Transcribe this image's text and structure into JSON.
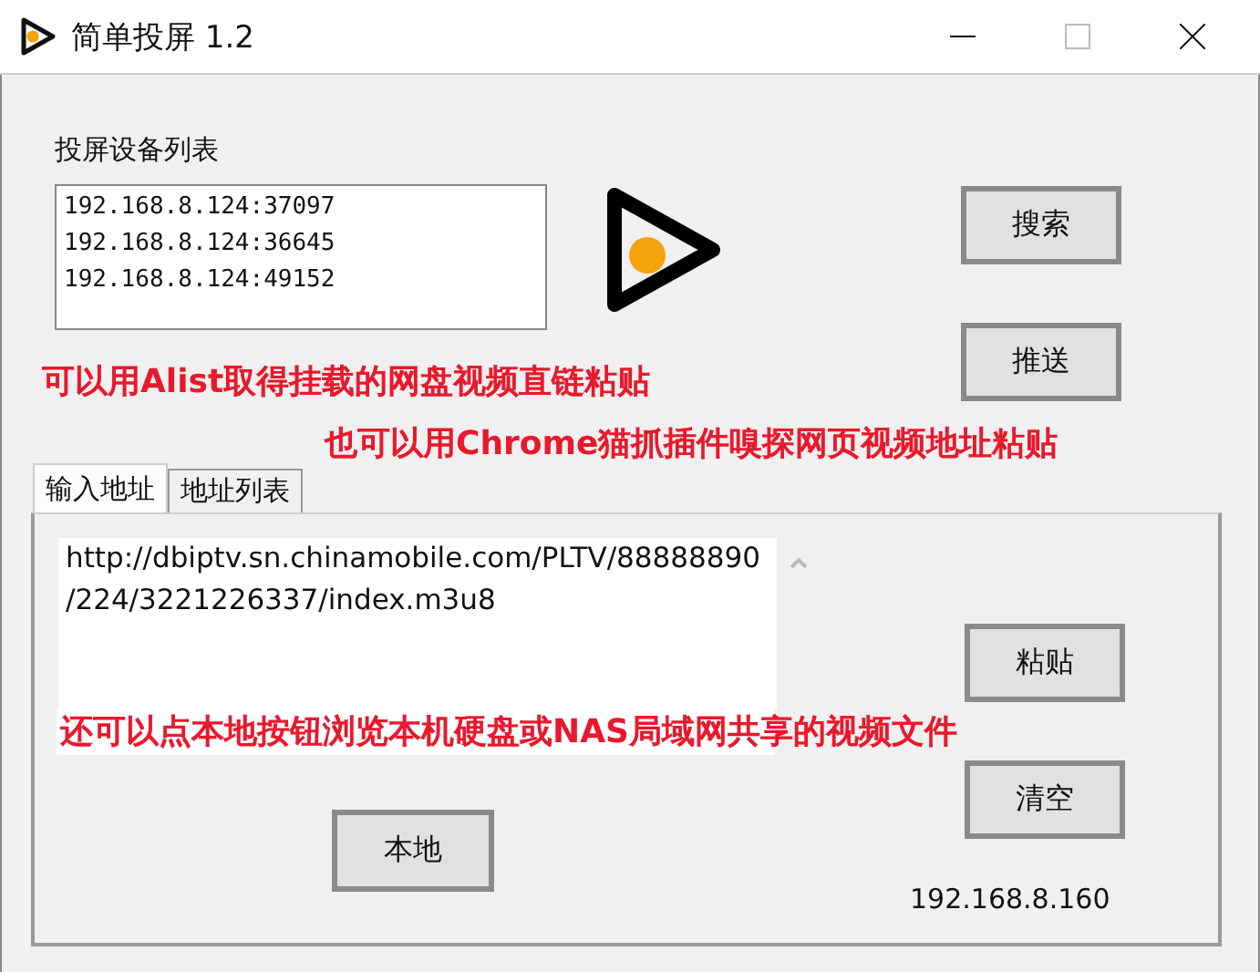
{
  "window": {
    "title": "简单投屏 1.2"
  },
  "device_list": {
    "label": "投屏设备列表",
    "items": [
      "192.168.8.124:37097",
      "192.168.8.124:36645",
      "192.168.8.124:49152"
    ]
  },
  "side_buttons": [
    "搜索",
    "推送"
  ],
  "notes": [
    "可以用Alist取得挂载的网盘视频直链粘贴",
    "也可以用Chrome猫抓插件嗅探网页视频地址粘贴",
    "还可以点本地按钮浏览本机硬盘或NAS局域网共享的视频文件"
  ],
  "tabs": [
    {
      "label": "输入地址",
      "selected": true
    },
    {
      "label": "地址列表",
      "selected": false
    }
  ],
  "url_field": {
    "value": "http://dbiptv.sn.chinamobile.com/PLTV/88888890/224/3221226337/index.m3u8"
  },
  "panel_buttons": [
    "粘贴",
    "清空"
  ],
  "local_button": "本地",
  "local_ip": "192.168.8.160"
}
